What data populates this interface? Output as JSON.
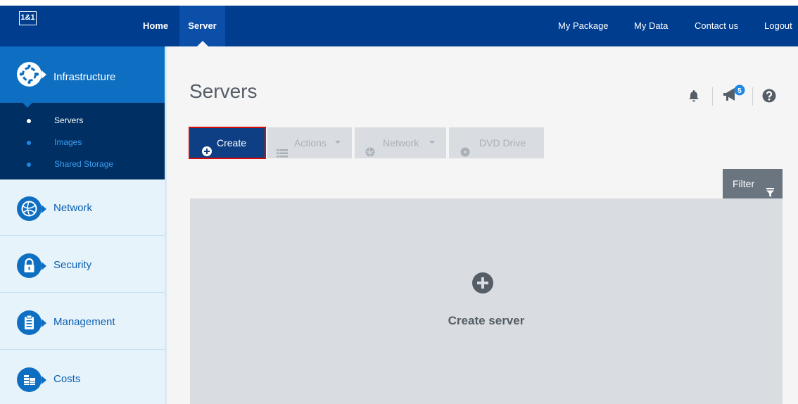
{
  "brand": {
    "logo_text": "1&1"
  },
  "topnav": {
    "left": [
      "Home",
      "Server"
    ],
    "right": [
      "My Package",
      "My Data",
      "Contact us",
      "Logout"
    ]
  },
  "sidebar": {
    "active_section": "Infrastructure",
    "sub_items": [
      "Servers",
      "Images",
      "Shared Storage"
    ],
    "sections": [
      "Network",
      "Security",
      "Management",
      "Costs"
    ]
  },
  "header": {
    "title": "Servers",
    "notification_badge": "5"
  },
  "toolbar": {
    "create": "Create",
    "actions": "Actions",
    "network": "Network",
    "dvd": "DVD Drive",
    "filter": "Filter"
  },
  "panel": {
    "label": "Create server"
  },
  "colors": {
    "topbar": "#003d8f",
    "active_blue": "#0e6fc2",
    "subnav": "#003063",
    "create_button": "#0e3f85",
    "highlight_border": "#d40c0c",
    "disabled_button": "#d9dde1"
  }
}
